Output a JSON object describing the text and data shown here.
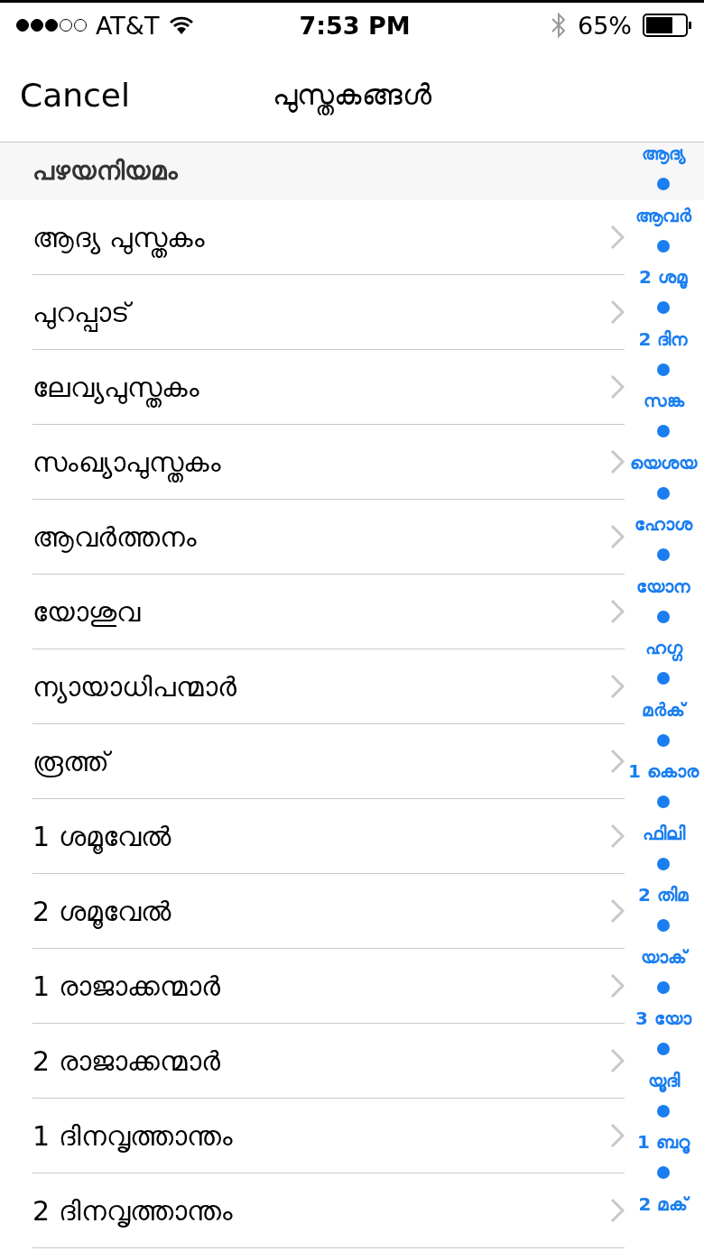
{
  "status_bar": {
    "signal_dots": [
      {
        "filled": true
      },
      {
        "filled": true
      },
      {
        "filled": true
      },
      {
        "filled": false
      },
      {
        "filled": false
      }
    ],
    "carrier": "AT&T",
    "time": "7:53 PM",
    "battery": "65%"
  },
  "nav": {
    "cancel": "Cancel",
    "title": "പുസ്തകങ്ങൾ"
  },
  "section": {
    "title": "പഴയനിയമം"
  },
  "rows": [
    "ആദ്യ പുസ്തകം",
    "പുറപ്പാട്",
    "ലേവ്യപുസ്തകം",
    "സംഖ്യാപുസ്തകം",
    "ആവർത്തനം",
    "യോശുവ",
    "ന്യായാധിപന്മാർ",
    "രൂത്ത്",
    "1 ശമൂവേൽ",
    "2 ശമൂവേൽ",
    "1 രാജാക്കന്മാർ",
    "2 രാജാക്കന്മാർ",
    "1 ദിനവൃത്താന്തം",
    "2 ദിനവൃത്താന്തം"
  ],
  "index": [
    "ആദ്യ",
    "ആവർ",
    "2 ശമൂ",
    "2 ദിന",
    "സങ്ക",
    "യെശയ",
    "ഹോശ",
    "യോന",
    "ഹഗ്ഗ",
    "മർക്",
    "1 കൊര",
    "ഫിലി",
    "2 തിമ",
    "യാക്",
    "3 യോ",
    "യൂദി",
    "1 ബറൂ",
    "2 മക്"
  ]
}
